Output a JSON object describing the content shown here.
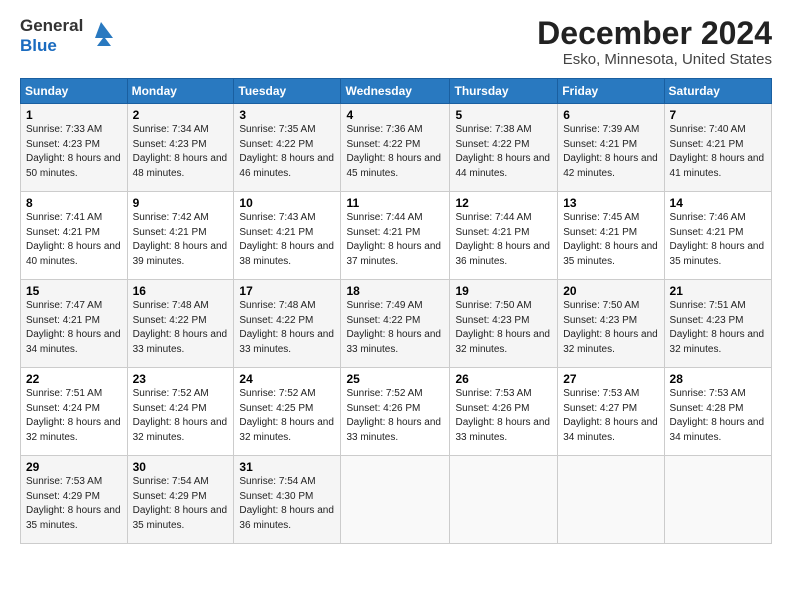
{
  "logo": {
    "general": "General",
    "blue": "Blue"
  },
  "header": {
    "month": "December 2024",
    "location": "Esko, Minnesota, United States"
  },
  "weekdays": [
    "Sunday",
    "Monday",
    "Tuesday",
    "Wednesday",
    "Thursday",
    "Friday",
    "Saturday"
  ],
  "weeks": [
    [
      {
        "day": "1",
        "sunrise": "7:33 AM",
        "sunset": "4:23 PM",
        "daylight": "8 hours and 50 minutes."
      },
      {
        "day": "2",
        "sunrise": "7:34 AM",
        "sunset": "4:23 PM",
        "daylight": "8 hours and 48 minutes."
      },
      {
        "day": "3",
        "sunrise": "7:35 AM",
        "sunset": "4:22 PM",
        "daylight": "8 hours and 46 minutes."
      },
      {
        "day": "4",
        "sunrise": "7:36 AM",
        "sunset": "4:22 PM",
        "daylight": "8 hours and 45 minutes."
      },
      {
        "day": "5",
        "sunrise": "7:38 AM",
        "sunset": "4:22 PM",
        "daylight": "8 hours and 44 minutes."
      },
      {
        "day": "6",
        "sunrise": "7:39 AM",
        "sunset": "4:21 PM",
        "daylight": "8 hours and 42 minutes."
      },
      {
        "day": "7",
        "sunrise": "7:40 AM",
        "sunset": "4:21 PM",
        "daylight": "8 hours and 41 minutes."
      }
    ],
    [
      {
        "day": "8",
        "sunrise": "7:41 AM",
        "sunset": "4:21 PM",
        "daylight": "8 hours and 40 minutes."
      },
      {
        "day": "9",
        "sunrise": "7:42 AM",
        "sunset": "4:21 PM",
        "daylight": "8 hours and 39 minutes."
      },
      {
        "day": "10",
        "sunrise": "7:43 AM",
        "sunset": "4:21 PM",
        "daylight": "8 hours and 38 minutes."
      },
      {
        "day": "11",
        "sunrise": "7:44 AM",
        "sunset": "4:21 PM",
        "daylight": "8 hours and 37 minutes."
      },
      {
        "day": "12",
        "sunrise": "7:44 AM",
        "sunset": "4:21 PM",
        "daylight": "8 hours and 36 minutes."
      },
      {
        "day": "13",
        "sunrise": "7:45 AM",
        "sunset": "4:21 PM",
        "daylight": "8 hours and 35 minutes."
      },
      {
        "day": "14",
        "sunrise": "7:46 AM",
        "sunset": "4:21 PM",
        "daylight": "8 hours and 35 minutes."
      }
    ],
    [
      {
        "day": "15",
        "sunrise": "7:47 AM",
        "sunset": "4:21 PM",
        "daylight": "8 hours and 34 minutes."
      },
      {
        "day": "16",
        "sunrise": "7:48 AM",
        "sunset": "4:22 PM",
        "daylight": "8 hours and 33 minutes."
      },
      {
        "day": "17",
        "sunrise": "7:48 AM",
        "sunset": "4:22 PM",
        "daylight": "8 hours and 33 minutes."
      },
      {
        "day": "18",
        "sunrise": "7:49 AM",
        "sunset": "4:22 PM",
        "daylight": "8 hours and 33 minutes."
      },
      {
        "day": "19",
        "sunrise": "7:50 AM",
        "sunset": "4:23 PM",
        "daylight": "8 hours and 32 minutes."
      },
      {
        "day": "20",
        "sunrise": "7:50 AM",
        "sunset": "4:23 PM",
        "daylight": "8 hours and 32 minutes."
      },
      {
        "day": "21",
        "sunrise": "7:51 AM",
        "sunset": "4:23 PM",
        "daylight": "8 hours and 32 minutes."
      }
    ],
    [
      {
        "day": "22",
        "sunrise": "7:51 AM",
        "sunset": "4:24 PM",
        "daylight": "8 hours and 32 minutes."
      },
      {
        "day": "23",
        "sunrise": "7:52 AM",
        "sunset": "4:24 PM",
        "daylight": "8 hours and 32 minutes."
      },
      {
        "day": "24",
        "sunrise": "7:52 AM",
        "sunset": "4:25 PM",
        "daylight": "8 hours and 32 minutes."
      },
      {
        "day": "25",
        "sunrise": "7:52 AM",
        "sunset": "4:26 PM",
        "daylight": "8 hours and 33 minutes."
      },
      {
        "day": "26",
        "sunrise": "7:53 AM",
        "sunset": "4:26 PM",
        "daylight": "8 hours and 33 minutes."
      },
      {
        "day": "27",
        "sunrise": "7:53 AM",
        "sunset": "4:27 PM",
        "daylight": "8 hours and 34 minutes."
      },
      {
        "day": "28",
        "sunrise": "7:53 AM",
        "sunset": "4:28 PM",
        "daylight": "8 hours and 34 minutes."
      }
    ],
    [
      {
        "day": "29",
        "sunrise": "7:53 AM",
        "sunset": "4:29 PM",
        "daylight": "8 hours and 35 minutes."
      },
      {
        "day": "30",
        "sunrise": "7:54 AM",
        "sunset": "4:29 PM",
        "daylight": "8 hours and 35 minutes."
      },
      {
        "day": "31",
        "sunrise": "7:54 AM",
        "sunset": "4:30 PM",
        "daylight": "8 hours and 36 minutes."
      },
      null,
      null,
      null,
      null
    ]
  ]
}
